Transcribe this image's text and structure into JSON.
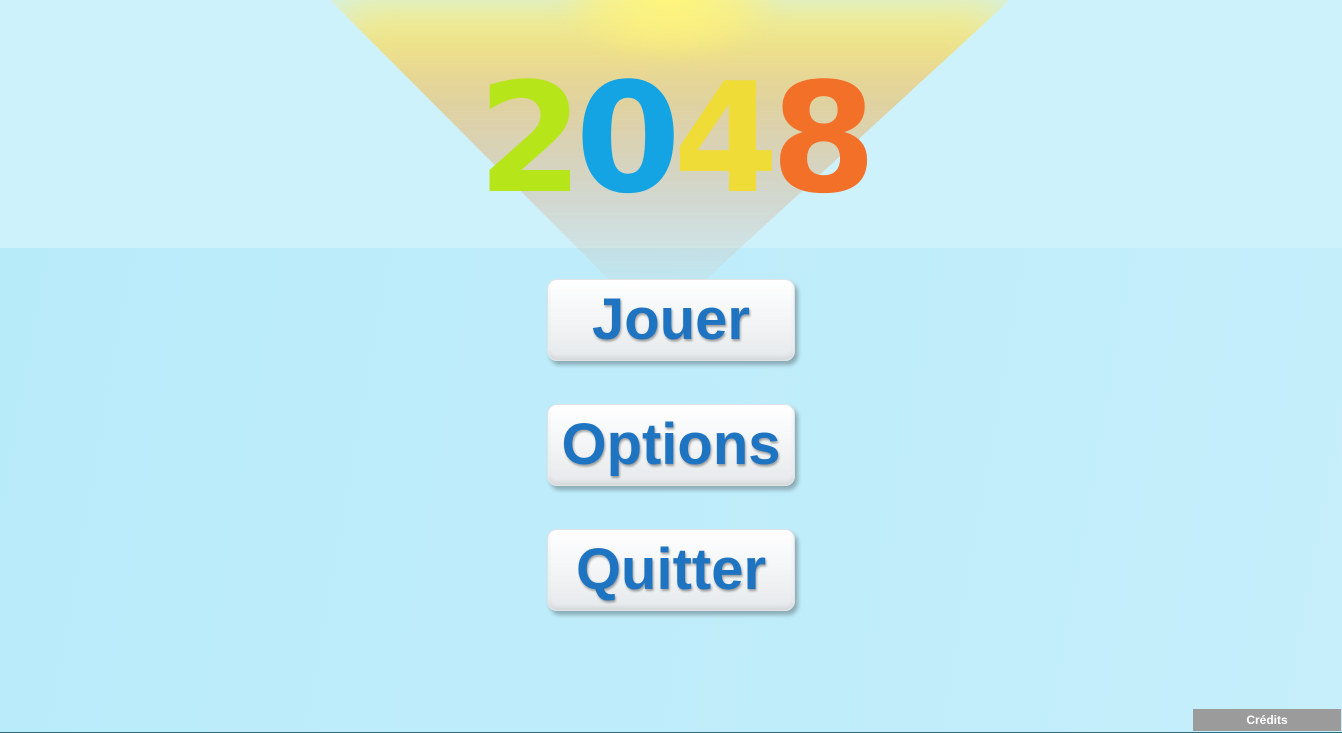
{
  "title": {
    "digits": [
      "2",
      "0",
      "4",
      "8"
    ]
  },
  "menu": {
    "play_label": "Jouer",
    "options_label": "Options",
    "quit_label": "Quitter"
  },
  "credits": {
    "label": "Crédits"
  },
  "colors": {
    "digit_2": "#b6e51a",
    "digit_0": "#14a4e4",
    "digit_4": "#f0dc36",
    "digit_8": "#f37028",
    "button_text": "#1f74c2",
    "background_top": "#cef2fc",
    "background_bottom": "#bcebfa",
    "credits_bg": "#9b9b9b"
  }
}
